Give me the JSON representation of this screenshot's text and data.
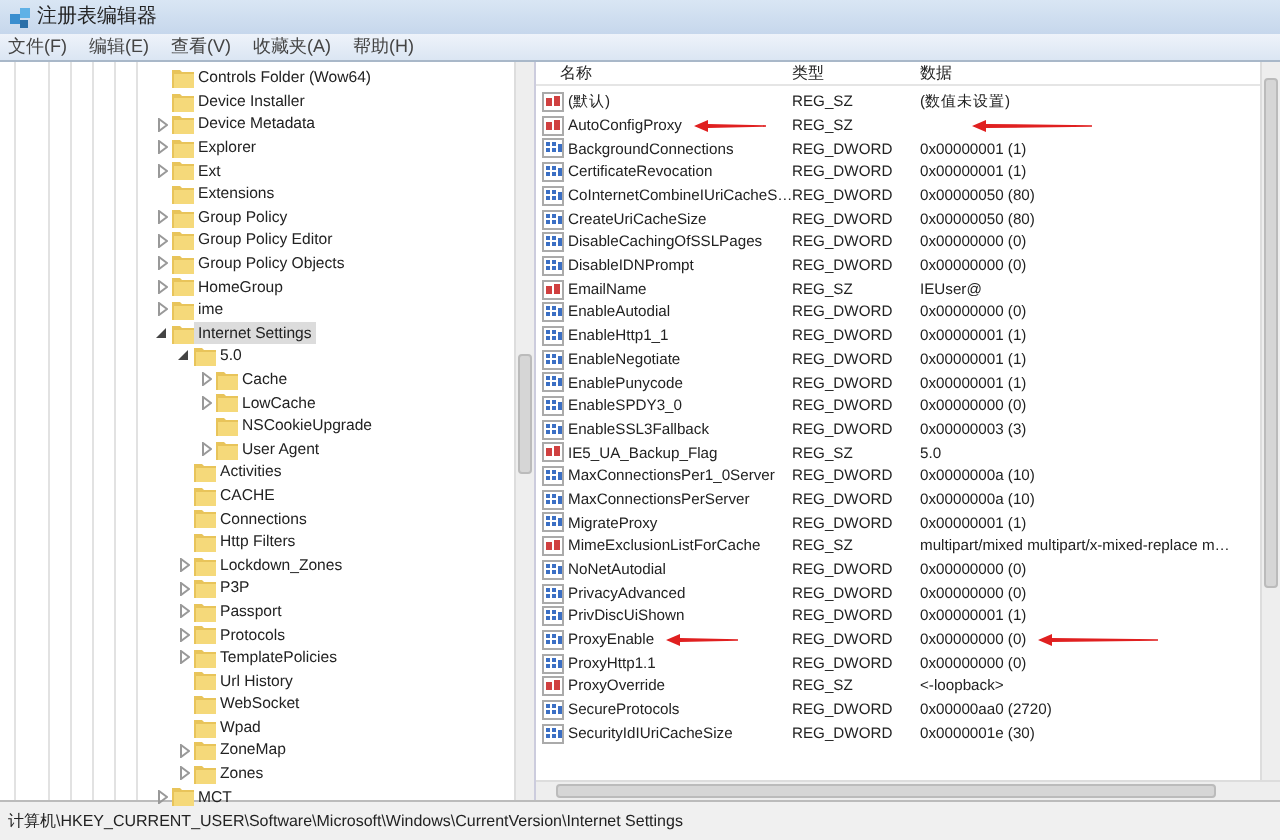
{
  "window": {
    "title": "注册表编辑器"
  },
  "menu": [
    "文件(F)",
    "编辑(E)",
    "查看(V)",
    "收藏夹(A)",
    "帮助(H)"
  ],
  "tree": [
    {
      "label": "Controls Folder (Wow64)"
    },
    {
      "label": "Device Installer"
    },
    {
      "label": "Device Metadata",
      "expanded": false
    },
    {
      "label": "Explorer",
      "expanded": false
    },
    {
      "label": "Ext",
      "expanded": false
    },
    {
      "label": "Extensions"
    },
    {
      "label": "Group Policy",
      "expanded": false
    },
    {
      "label": "Group Policy Editor",
      "expanded": false
    },
    {
      "label": "Group Policy Objects",
      "expanded": false
    },
    {
      "label": "HomeGroup",
      "expanded": false
    },
    {
      "label": "ime",
      "expanded": false
    },
    {
      "label": "Internet Settings",
      "expanded": true,
      "selected": true,
      "children": [
        {
          "label": "5.0",
          "expanded": true,
          "children": [
            {
              "label": "Cache",
              "expanded": false
            },
            {
              "label": "LowCache",
              "expanded": false
            },
            {
              "label": "NSCookieUpgrade"
            },
            {
              "label": "User Agent",
              "expanded": false
            }
          ]
        },
        {
          "label": "Activities"
        },
        {
          "label": "CACHE"
        },
        {
          "label": "Connections"
        },
        {
          "label": "Http Filters"
        },
        {
          "label": "Lockdown_Zones",
          "expanded": false
        },
        {
          "label": "P3P",
          "expanded": false
        },
        {
          "label": "Passport",
          "expanded": false
        },
        {
          "label": "Protocols",
          "expanded": false
        },
        {
          "label": "TemplatePolicies",
          "expanded": false
        },
        {
          "label": "Url History"
        },
        {
          "label": "WebSocket"
        },
        {
          "label": "Wpad"
        },
        {
          "label": "ZoneMap",
          "expanded": false
        },
        {
          "label": "Zones",
          "expanded": false
        }
      ]
    },
    {
      "label": "MCT",
      "expanded": false
    }
  ],
  "values": {
    "columns": [
      "名称",
      "类型",
      "数据"
    ],
    "rows": [
      {
        "kind": "string",
        "name": "(默认)",
        "type": "REG_SZ",
        "data": "(数值未设置)",
        "marked": false
      },
      {
        "kind": "string",
        "name": "AutoConfigProxy",
        "type": "REG_SZ",
        "marked": true
      },
      {
        "kind": "number",
        "name": "BackgroundConnections",
        "type": "REG_DWORD",
        "data": "0x00000001 (1)",
        "marked": false
      },
      {
        "kind": "number",
        "name": "CertificateRevocation",
        "type": "REG_DWORD",
        "data": "0x00000001 (1)",
        "marked": false
      },
      {
        "kind": "number",
        "name": "CoInternetCombineIUriCacheS…",
        "type": "REG_DWORD",
        "data": "0x00000050 (80)",
        "marked": false
      },
      {
        "kind": "number",
        "name": "CreateUriCacheSize",
        "type": "REG_DWORD",
        "data": "0x00000050 (80)",
        "marked": false
      },
      {
        "kind": "number",
        "name": "DisableCachingOfSSLPages",
        "type": "REG_DWORD",
        "data": "0x00000000 (0)",
        "marked": false
      },
      {
        "kind": "number",
        "name": "DisableIDNPrompt",
        "type": "REG_DWORD",
        "data": "0x00000000 (0)",
        "marked": false
      },
      {
        "kind": "string",
        "name": "EmailName",
        "type": "REG_SZ",
        "data": "IEUser@",
        "marked": false
      },
      {
        "kind": "number",
        "name": "EnableAutodial",
        "type": "REG_DWORD",
        "data": "0x00000000 (0)",
        "marked": false
      },
      {
        "kind": "number",
        "name": "EnableHttp1_1",
        "type": "REG_DWORD",
        "data": "0x00000001 (1)",
        "marked": false
      },
      {
        "kind": "number",
        "name": "EnableNegotiate",
        "type": "REG_DWORD",
        "data": "0x00000001 (1)",
        "marked": false
      },
      {
        "kind": "number",
        "name": "EnablePunycode",
        "type": "REG_DWORD",
        "data": "0x00000001 (1)",
        "marked": false
      },
      {
        "kind": "number",
        "name": "EnableSPDY3_0",
        "type": "REG_DWORD",
        "data": "0x00000000 (0)",
        "marked": false
      },
      {
        "kind": "number",
        "name": "EnableSSL3Fallback",
        "type": "REG_DWORD",
        "data": "0x00000003 (3)",
        "marked": false
      },
      {
        "kind": "string",
        "name": "IE5_UA_Backup_Flag",
        "type": "REG_SZ",
        "data": "5.0",
        "marked": false
      },
      {
        "kind": "number",
        "name": "MaxConnectionsPer1_0Server",
        "type": "REG_DWORD",
        "data": "0x0000000a (10)",
        "marked": false
      },
      {
        "kind": "number",
        "name": "MaxConnectionsPerServer",
        "type": "REG_DWORD",
        "data": "0x0000000a (10)",
        "marked": false
      },
      {
        "kind": "number",
        "name": "MigrateProxy",
        "type": "REG_DWORD",
        "data": "0x00000001 (1)",
        "marked": false
      },
      {
        "kind": "string",
        "name": "MimeExclusionListForCache",
        "type": "REG_SZ",
        "data": "multipart/mixed multipart/x-mixed-replace m…",
        "marked": false
      },
      {
        "kind": "number",
        "name": "NoNetAutodial",
        "type": "REG_DWORD",
        "data": "0x00000000 (0)",
        "marked": false
      },
      {
        "kind": "number",
        "name": "PrivacyAdvanced",
        "type": "REG_DWORD",
        "data": "0x00000000 (0)",
        "marked": false
      },
      {
        "kind": "number",
        "name": "PrivDiscUiShown",
        "type": "REG_DWORD",
        "data": "0x00000001 (1)",
        "marked": false
      },
      {
        "kind": "number",
        "name": "ProxyEnable",
        "type": "REG_DWORD",
        "data": "0x00000000 (0)",
        "marked": true
      },
      {
        "kind": "number",
        "name": "ProxyHttp1.1",
        "type": "REG_DWORD",
        "data": "0x00000000 (0)",
        "marked": false
      },
      {
        "kind": "string",
        "name": "ProxyOverride",
        "type": "REG_SZ",
        "data": "<-loopback>",
        "marked": false
      },
      {
        "kind": "number",
        "name": "SecureProtocols",
        "type": "REG_DWORD",
        "data": "0x00000aa0 (2720)",
        "marked": false
      },
      {
        "kind": "number",
        "name": "SecurityIdIUriCacheSize",
        "type": "REG_DWORD",
        "data": "0x0000001e (30)",
        "marked": false
      }
    ]
  },
  "status_bar": "计算机\\HKEY_CURRENT_USER\\Software\\Microsoft\\Windows\\CurrentVersion\\Internet Settings"
}
